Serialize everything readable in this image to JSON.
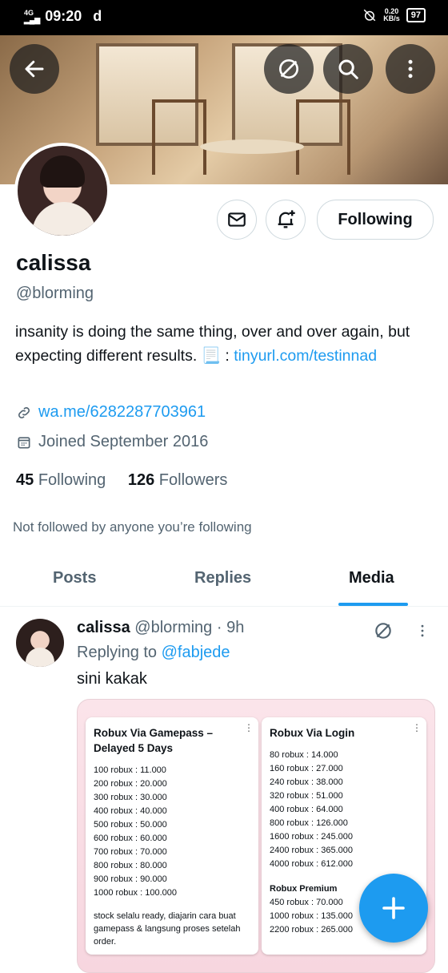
{
  "status_bar": {
    "network": "4G",
    "time": "09:20",
    "carrier_icon": "d",
    "speed_value": "0.20",
    "speed_unit": "KB/s",
    "battery": "97"
  },
  "profile": {
    "name": "calissa",
    "handle": "@blorming",
    "bio_text": "insanity is doing the same thing, over and over again, but expecting different results. 📃 : ",
    "bio_link": "tinyurl.com/testinnad",
    "website": "wa.me/6282287703961",
    "joined": "Joined September 2016",
    "following_count": "45",
    "following_label": "Following",
    "followers_count": "126",
    "followers_label": "Followers",
    "not_followed": "Not followed by anyone you’re following",
    "following_button": "Following"
  },
  "tabs": [
    "Posts",
    "Replies",
    "Media"
  ],
  "active_tab": "Media",
  "tweet": {
    "name": "calissa",
    "handle": "@blorming",
    "time": "· 9h",
    "replying_prefix": "Replying to ",
    "replying_to": "@fabjede",
    "text": "sini kakak"
  },
  "media": {
    "card1": {
      "title": "Robux Via Gamepass – Delayed 5 Days",
      "lines": [
        "100 robux : 11.000",
        "200 robux : 20.000",
        "300 robux : 30.000",
        "400 robux : 40.000",
        "500 robux : 50.000",
        "600 robux : 60.000",
        "700 robux : 70.000",
        "800 robux : 80.000",
        "900 robux : 90.000",
        "1000 robux : 100.000"
      ],
      "note": "stock selalu ready, diajarin cara buat gamepass & langsung proses setelah order."
    },
    "card2": {
      "title": "Robux Via Login",
      "lines": [
        "80 robux : 14.000",
        "160 robux : 27.000",
        "240 robux : 38.000",
        "320 robux : 51.000",
        "400 robux : 64.000",
        "800 robux : 126.000",
        "1600 robux : 245.000",
        "2400 robux : 365.000",
        "4000 robux : 612.000"
      ],
      "premium_title": "Robux Premium",
      "premium_lines": [
        "450 robux : 70.000",
        "1000 robux : 135.000",
        "2200 robux : 265.000"
      ]
    }
  },
  "icons": {
    "back": "arrow-left-icon",
    "hide": "no-symbol-icon",
    "search": "search-icon",
    "more": "more-vertical-icon",
    "message": "envelope-icon",
    "notify": "bell-plus-icon",
    "link": "link-icon",
    "calendar": "calendar-icon",
    "compose": "plus-icon"
  },
  "colors": {
    "accent": "#1d9bf0",
    "muted": "#536471",
    "text": "#0f1419"
  }
}
